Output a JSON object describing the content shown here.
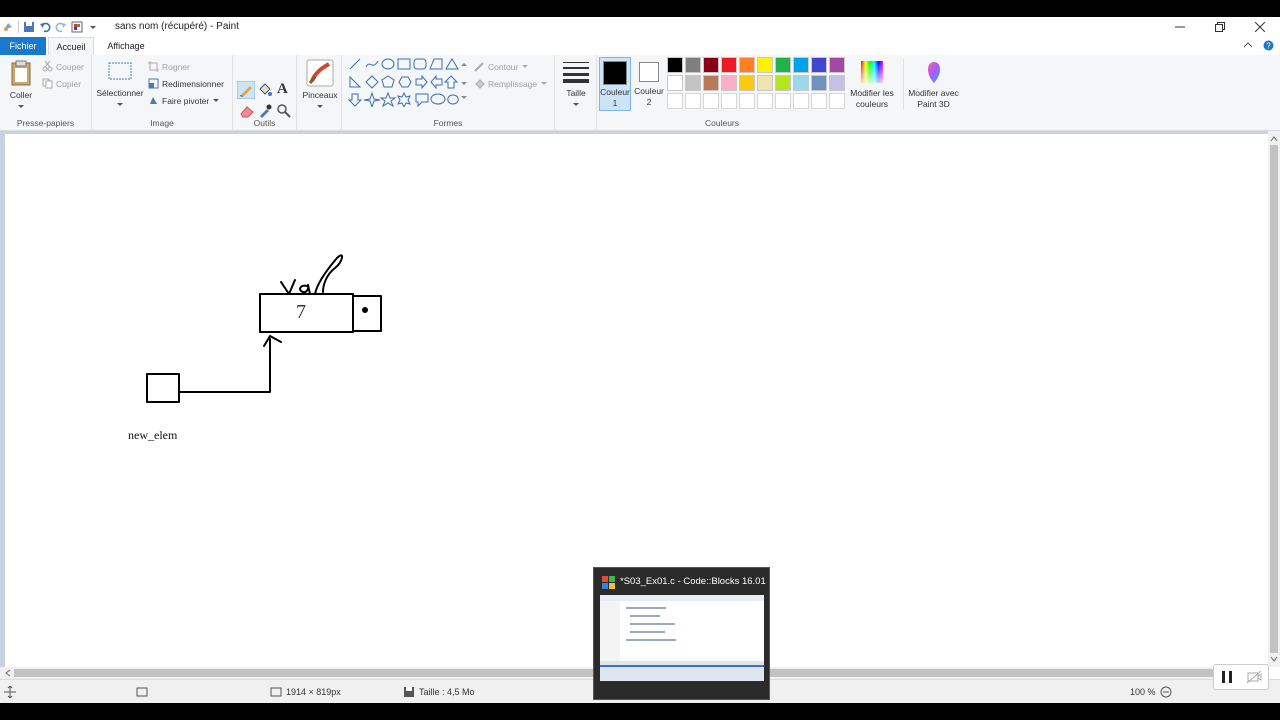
{
  "window": {
    "title": "sans nom (récupéré) - Paint",
    "controls": [
      "minimize",
      "restore",
      "close"
    ]
  },
  "tabs": {
    "file": "Fichier",
    "home": "Accueil",
    "view": "Affichage"
  },
  "ribbon": {
    "clipboard": {
      "label": "Presse-papiers",
      "paste": "Coller",
      "cut": "Couper",
      "copy": "Copier"
    },
    "image": {
      "label": "Image",
      "select": "Sélectionner",
      "crop": "Rogner",
      "resize": "Redimensionner",
      "rotate": "Faire pivoter"
    },
    "tools": {
      "label": "Outils"
    },
    "brushes": {
      "label": "Pinceaux"
    },
    "shapes": {
      "label": "Formes",
      "outline": "Contour",
      "fill": "Remplissage"
    },
    "size": {
      "label": "Taille"
    },
    "colors": {
      "label": "Couleurs",
      "color1": "Couleur",
      "color1_num": "1",
      "color2": "Couleur",
      "color2_num": "2",
      "edit": "Modifier les",
      "edit2": "couleurs",
      "paint3d": "Modifier avec",
      "paint3d2": "Paint 3D",
      "color1_value": "#000000",
      "color2_value": "#ffffff",
      "palette_row1": [
        "#000000",
        "#7f7f7f",
        "#880015",
        "#ed1c24",
        "#ff7f27",
        "#fff200",
        "#22b14c",
        "#00a2e8",
        "#3f48cc",
        "#a349a4"
      ],
      "palette_row2": [
        "#ffffff",
        "#c3c3c3",
        "#b97a57",
        "#ffaec9",
        "#ffc90e",
        "#efe4b0",
        "#b5e61d",
        "#99d9ea",
        "#7092be",
        "#c8bfe7"
      ]
    }
  },
  "canvas": {
    "label_text": "new_elem",
    "node_value": "7",
    "handwriting": "val"
  },
  "status": {
    "dimensions": "1914 × 819px",
    "size": "Taille : 4,5 Mo",
    "zoom": "100 %"
  },
  "taskbar_preview": {
    "title": "*S03_Ex01.c - Code::Blocks 16.01"
  }
}
